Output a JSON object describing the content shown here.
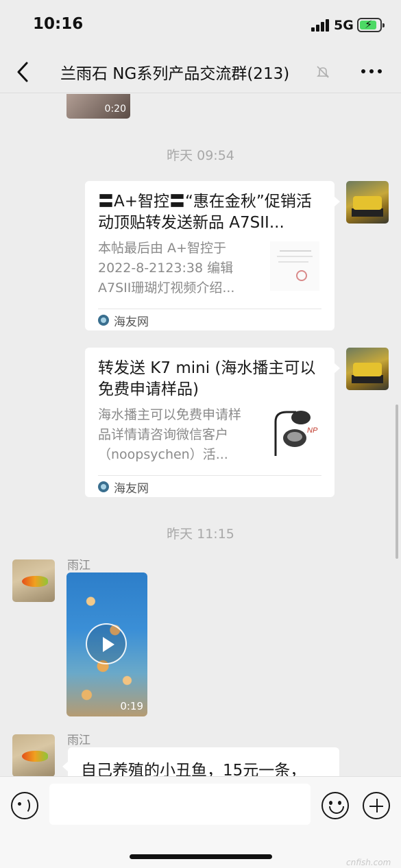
{
  "status_bar": {
    "time": "10:16",
    "network": "5G",
    "battery_icon": "battery-charging-icon"
  },
  "header": {
    "title": "兰雨石 NG系列产品交流群(213)",
    "back_icon": "chevron-left-icon",
    "mute_icon": "mute-bell-icon",
    "more_icon": "more-dots-icon"
  },
  "messages": {
    "top_video": {
      "duration": "0:20"
    },
    "time_1": "昨天 09:54",
    "card_1": {
      "title": "〓A+智控〓“惠在金秋”促销活动顶贴转发送新品 A7SII...",
      "desc": "本帖最后由 A+智控于 2022-8-2123:38 编辑 A7SII珊瑚灯视频介绍...",
      "source": "海友网"
    },
    "card_2": {
      "title": "转发送 K7 mini (海水播主可以免费申请样品)",
      "desc": "海水播主可以免费申请样品详情请咨询微信客户（noopsychen）活...",
      "source": "海友网"
    },
    "time_2": "昨天 11:15",
    "sender_1": "雨江",
    "video_msg": {
      "duration": "0:19"
    },
    "sender_2": "雨江",
    "text_msg": "自己养殖的小丑鱼，15元一条，"
  },
  "input_bar": {
    "placeholder": "",
    "voice_icon": "voice-icon",
    "emoji_icon": "emoji-icon",
    "plus_icon": "plus-icon"
  },
  "watermark": "cnfish.com"
}
